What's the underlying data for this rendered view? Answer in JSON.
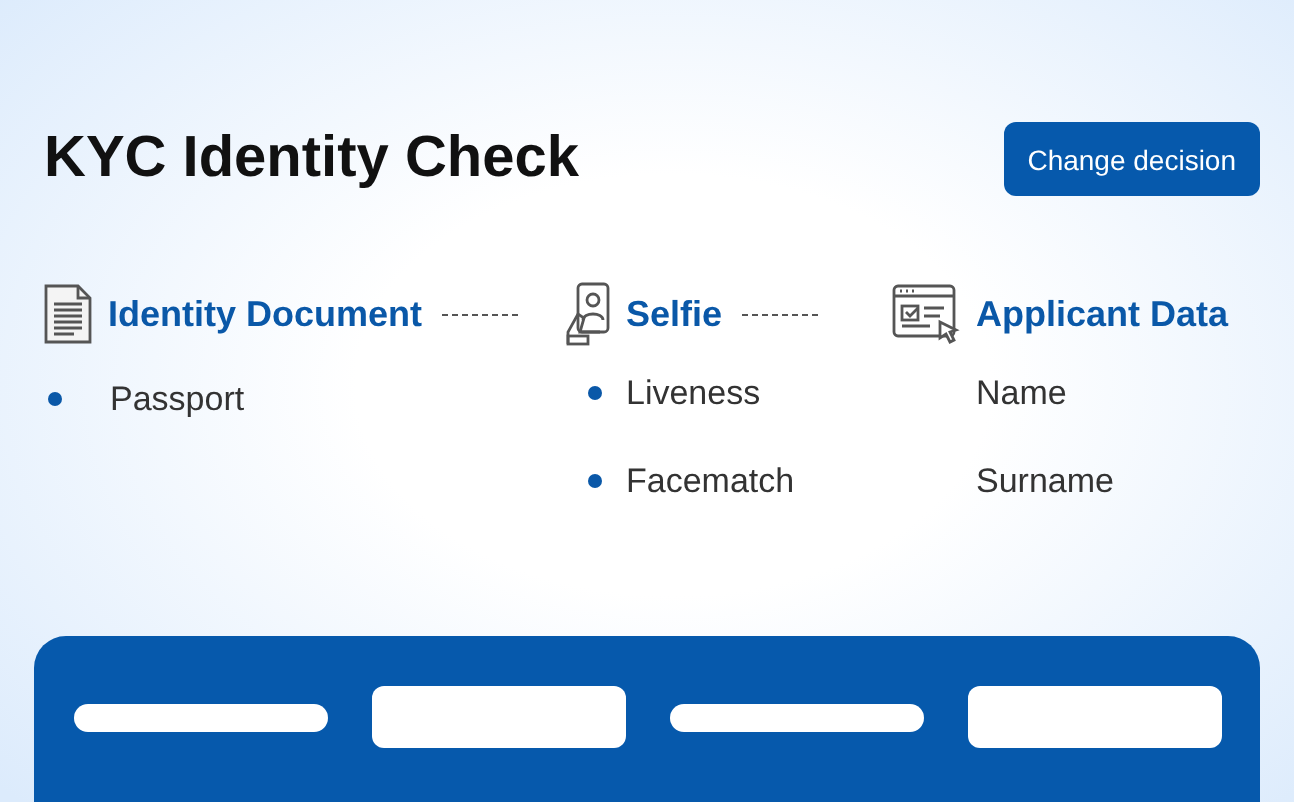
{
  "title": "KYC Identity Check",
  "action_button": "Change decision",
  "steps": [
    {
      "kind": "document",
      "title": "Identity Document",
      "items": [
        {
          "kind": "bullet",
          "label": "Passport"
        }
      ]
    },
    {
      "kind": "selfie",
      "title": "Selfie",
      "items": [
        {
          "kind": "bullet",
          "label": "Liveness"
        },
        {
          "kind": "bullet",
          "label": "Facematch"
        }
      ]
    },
    {
      "kind": "form",
      "title": "Applicant Data",
      "items": [
        {
          "kind": "plain",
          "label": "Name"
        },
        {
          "kind": "plain",
          "label": "Surname"
        }
      ]
    }
  ],
  "panel": {
    "placeholders": [
      {
        "kind": "line"
      },
      {
        "kind": "field"
      },
      {
        "kind": "line"
      },
      {
        "kind": "field"
      }
    ]
  }
}
